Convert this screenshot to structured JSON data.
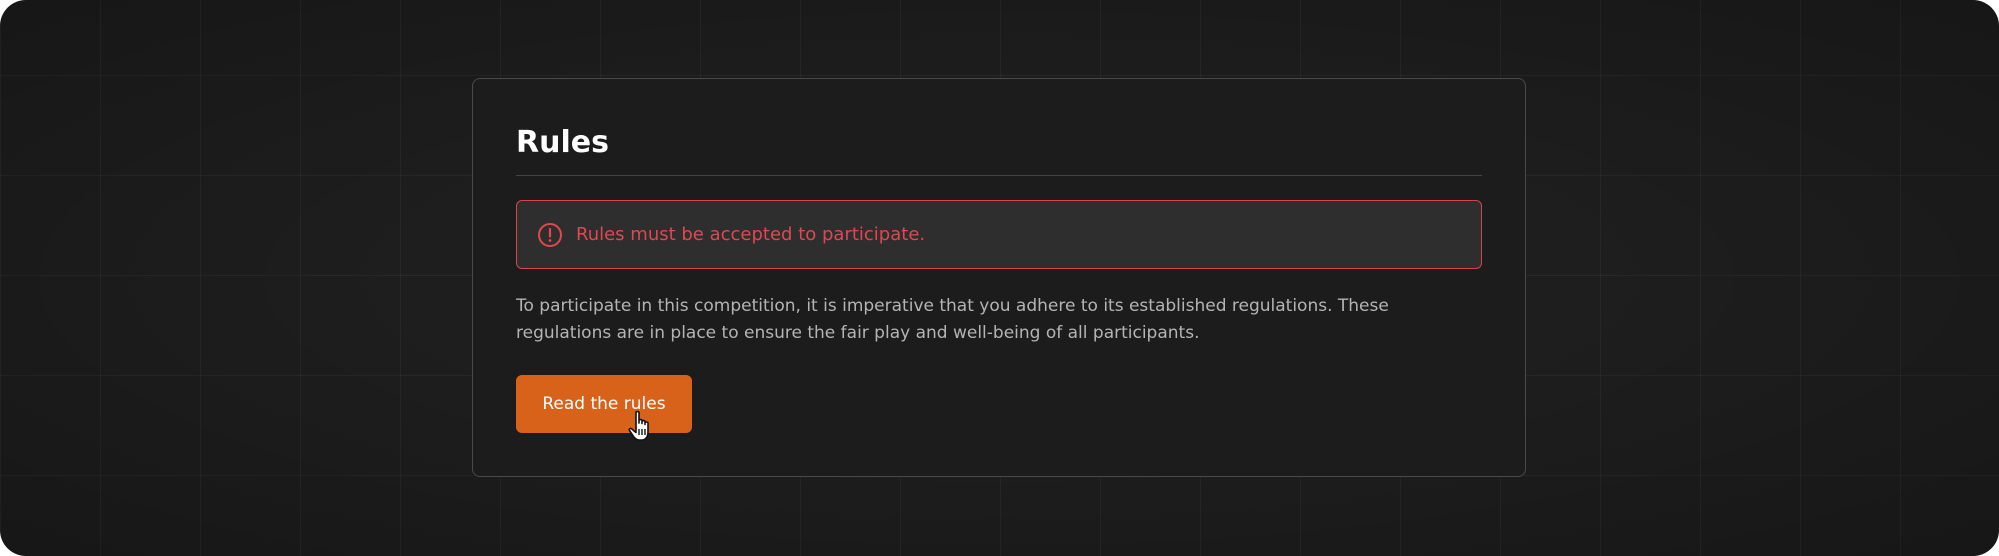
{
  "card": {
    "title": "Rules"
  },
  "alert": {
    "icon": "alert-circle-icon",
    "message": "Rules must be accepted to participate."
  },
  "description": "To participate in this competition, it is imperative that you adhere to its established regulations. These regulations are in place to ensure the fair play and well-being of all participants.",
  "button": {
    "label": "Read the rules"
  },
  "cursor": {
    "icon": "hand-pointer-icon"
  },
  "colors": {
    "background": "#1e1e1e",
    "card_border": "#4a4a4a",
    "alert_border": "#d9434a",
    "alert_text": "#e0484f",
    "button": "#d9621a"
  }
}
